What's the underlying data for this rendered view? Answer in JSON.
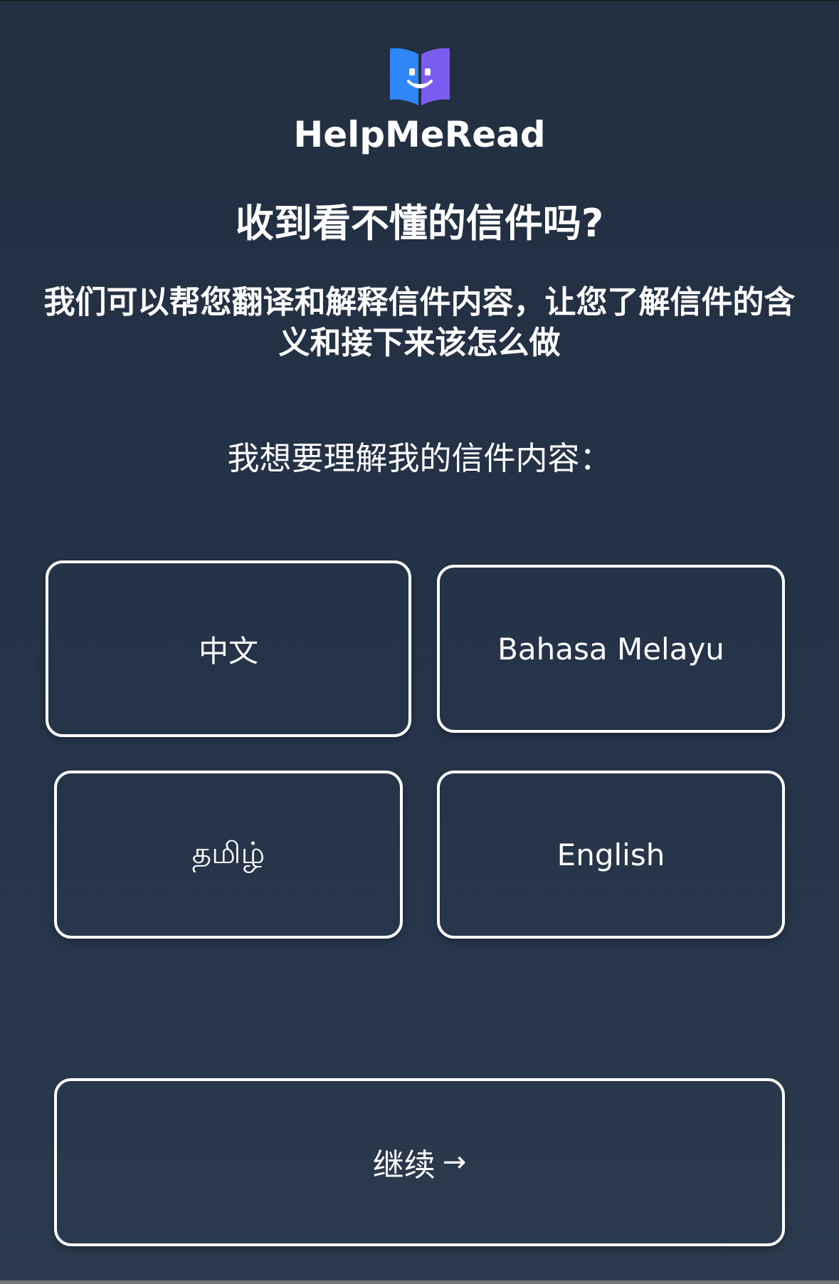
{
  "app": {
    "brand_name": "HelpMeRead",
    "logo_icon": "open-book-smile-icon",
    "colors": {
      "background": "#26344a",
      "logo_left": "#2f86f6",
      "logo_right": "#7b5cf0",
      "border": "#ffffff"
    }
  },
  "hero": {
    "headline": "收到看不懂的信件吗?",
    "subheadline": "我们可以帮您翻译和解释信件内容，让您了解信件的含义和接下来该怎么做"
  },
  "language_select": {
    "prompt": "我想要理解我的信件内容：",
    "options": [
      {
        "label": "中文"
      },
      {
        "label": "Bahasa Melayu"
      },
      {
        "label": "தமிழ்"
      },
      {
        "label": "English"
      }
    ]
  },
  "actions": {
    "continue_label": "继续",
    "continue_arrow": "→"
  }
}
